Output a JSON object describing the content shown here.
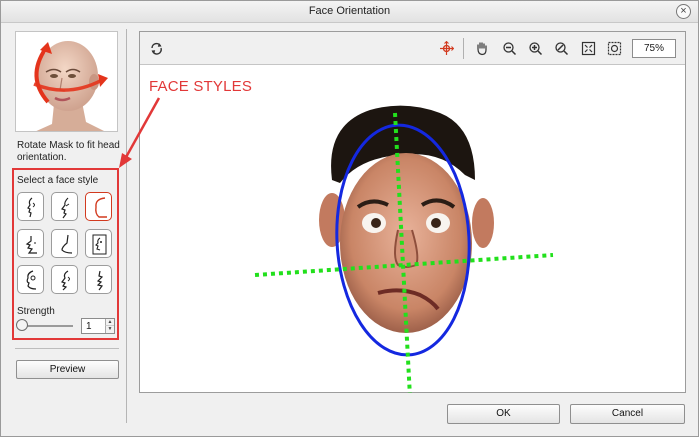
{
  "window": {
    "title": "Face Orientation",
    "close_glyph": "×"
  },
  "left_panel": {
    "thumbnail_icon": "rotate-head-icon",
    "hint": "Rotate Mask to fit head orientation.",
    "face_style": {
      "label": "Select a face style",
      "styles": [
        {
          "icon": "face-profile-style-1-icon",
          "selected": false
        },
        {
          "icon": "face-profile-style-2-icon",
          "selected": false
        },
        {
          "icon": "face-profile-style-3-icon",
          "selected": true
        },
        {
          "icon": "face-profile-style-4-icon",
          "selected": false
        },
        {
          "icon": "face-profile-style-5-icon",
          "selected": false
        },
        {
          "icon": "face-profile-style-6-icon",
          "selected": false
        },
        {
          "icon": "face-profile-style-7-icon",
          "selected": false
        },
        {
          "icon": "face-profile-style-8-icon",
          "selected": false
        },
        {
          "icon": "face-profile-style-9-icon",
          "selected": false
        }
      ]
    },
    "strength": {
      "label": "Strength",
      "value": "1",
      "slider_fraction": 0
    },
    "preview_label": "Preview"
  },
  "toolbar": {
    "tools": [
      "reset-icon",
      "move-pivot-icon",
      "pan-hand-icon",
      "zoom-out-icon",
      "zoom-in-icon",
      "zoom-reset-icon",
      "fit-view-icon",
      "actual-size-icon"
    ],
    "zoom_value": "75%"
  },
  "annotation": {
    "text": "FACE STYLES",
    "color": "#e23838"
  },
  "colors": {
    "mask_outline": "#1428e0",
    "guide_lines": "#22e01c",
    "accent": "#d23a1f"
  },
  "footer": {
    "ok_label": "OK",
    "cancel_label": "Cancel"
  }
}
